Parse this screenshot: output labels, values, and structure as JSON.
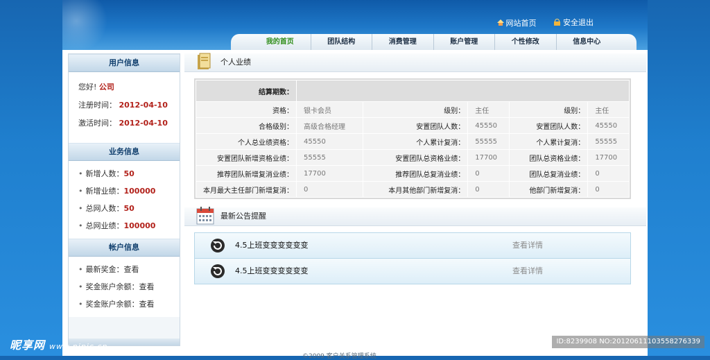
{
  "header": {
    "links": [
      {
        "label": "网站首页",
        "icon": "home-icon"
      },
      {
        "label": "安全退出",
        "icon": "lock-icon"
      }
    ],
    "nav": [
      "我的首页",
      "团队结构",
      "消费管理",
      "账户管理",
      "个性修改",
      "信息中心"
    ],
    "active_nav": "我的首页"
  },
  "sidebar": {
    "user_info": {
      "title": "用户信息",
      "greeting_label": "您好!",
      "greeting_name": "公司",
      "register_label": "注册时间：",
      "register_date": "2012-04-10",
      "activate_label": "激活时间：",
      "activate_date": "2012-04-10"
    },
    "business": {
      "title": "业务信息",
      "items": [
        {
          "label": "新增人数：",
          "value": "50"
        },
        {
          "label": "新增业绩：",
          "value": "100000"
        },
        {
          "label": "总网人数：",
          "value": "50"
        },
        {
          "label": "总网业绩：",
          "value": "100000"
        }
      ]
    },
    "account": {
      "title": "帐户信息",
      "items": [
        "最新奖金：查看",
        "奖金账户余额：查看",
        "奖金账户余额：查看"
      ]
    }
  },
  "performance": {
    "title": "个人业绩",
    "period_label": "结算期数：",
    "period_value": "",
    "rows": [
      [
        [
          "资格：",
          "银卡会员"
        ],
        [
          "级别：",
          "主任"
        ],
        [
          "级别：",
          "主任"
        ]
      ],
      [
        [
          "合格级别：",
          "高级合格经理"
        ],
        [
          "安置团队人数：",
          "45550"
        ],
        [
          "安置团队人数：",
          "45550"
        ]
      ],
      [
        [
          "个人总业绩资格：",
          "45550"
        ],
        [
          "个人累计复消：",
          "55555"
        ],
        [
          "个人累计复消：",
          "55555"
        ]
      ],
      [
        [
          "安置团队新增资格业绩：",
          "55555"
        ],
        [
          "安置团队总资格业绩：",
          "17700"
        ],
        [
          "团队总资格业绩：",
          "17700"
        ]
      ],
      [
        [
          "推荐团队新增复消业绩：",
          "17700"
        ],
        [
          "推荐团队总复消业绩：",
          "0"
        ],
        [
          "团队总复消业绩：",
          "0"
        ]
      ],
      [
        [
          "本月最大主任部门新增复消：",
          "0"
        ],
        [
          "本月其他部门新增复消：",
          "0"
        ],
        [
          "他部门新增复消：",
          "0"
        ]
      ]
    ]
  },
  "notices": {
    "title": "最新公告提醒",
    "items": [
      {
        "title": "4.5上班变变变变变变",
        "link": "查看详情"
      },
      {
        "title": "4.5上班变变变变变变",
        "link": "查看详情"
      }
    ]
  },
  "footer": "©2009 客户关系管理系统",
  "watermark": {
    "left": "昵享网",
    "left_url": "www.nipic.cn",
    "right": "ID:8239908 NO:20120611103558276339"
  }
}
